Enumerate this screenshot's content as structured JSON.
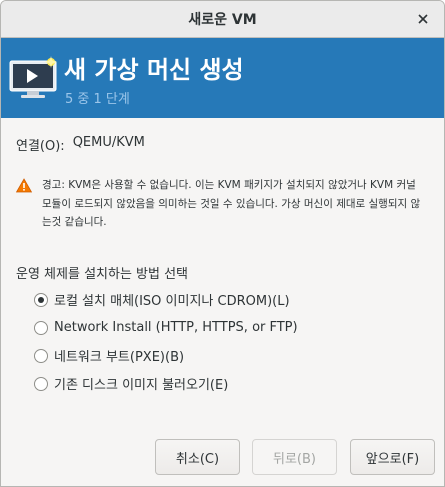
{
  "window": {
    "title": "새로운 VM",
    "close_label": "✕"
  },
  "banner": {
    "title": "새 가상 머신 생성",
    "step": "5 중 1 단계",
    "icon": "vm-display-icon",
    "background_color": "#2679b8"
  },
  "connection": {
    "label": "연결(O):",
    "value": "QEMU/KVM"
  },
  "warning": {
    "icon": "warning-triangle-icon",
    "text": "경고: KVM은 사용할 수 없습니다. 이는 KVM 패키지가 설치되지 않았거나 KVM 커널 모듈이 로드되지 않았음을 의미하는 것일 수 있습니다. 가상 머신이 제대로 실행되지 않는것 같습니다."
  },
  "install": {
    "section_label": "운영 체제를 설치하는 방법 선택",
    "options": [
      {
        "label": "로컬 설치 매체(ISO 이미지나 CDROM)(L)",
        "selected": true
      },
      {
        "label": "Network Install (HTTP, HTTPS, or FTP)",
        "selected": false
      },
      {
        "label": "네트워크 부트(PXE)(B)",
        "selected": false
      },
      {
        "label": "기존 디스크 이미지 불러오기(E)",
        "selected": false
      }
    ]
  },
  "footer": {
    "cancel_label": "취소(C)",
    "back_label": "뒤로(B)",
    "forward_label": "앞으로(F)"
  }
}
